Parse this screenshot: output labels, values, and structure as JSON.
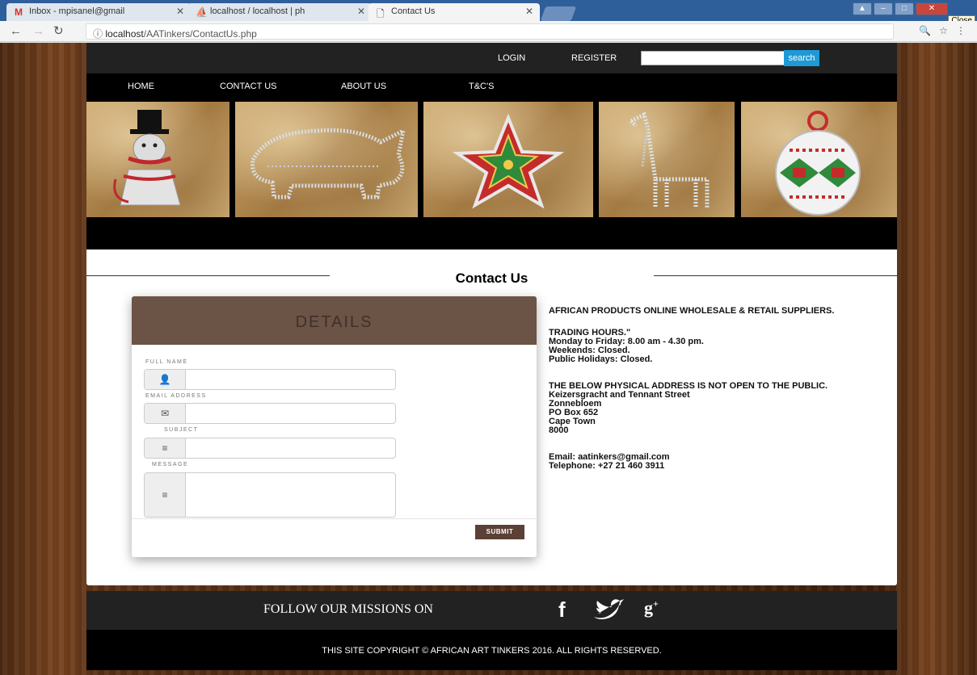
{
  "browser": {
    "tabs": [
      {
        "label": "Inbox - mpisanel@gmail",
        "icon": "gmail-icon"
      },
      {
        "label": "localhost / localhost | ph",
        "icon": "phpmyadmin-icon"
      },
      {
        "label": "Contact Us",
        "icon": "page-icon"
      }
    ],
    "close_tooltip": "Close",
    "url_prefix": "localhost",
    "url_path": "/AATinkers/ContactUs.php"
  },
  "topbar": {
    "login": "LOGIN",
    "register": "REGISTER",
    "search_value": "",
    "search_button": "search"
  },
  "nav": [
    "HOME",
    "CONTACT US",
    "ABOUT US",
    "T&C'S"
  ],
  "banner": {
    "items": [
      "snowman",
      "rhino",
      "star",
      "giraffe",
      "bauble"
    ]
  },
  "contact": {
    "title": "Contact Us",
    "form": {
      "header": "DETAILS",
      "full_name_label": "FULL NAME",
      "email_label": "EMAIL ADDRESS",
      "subject_label": "SUBJECT",
      "message_label": "MESSAGE",
      "submit": "SUBMIT"
    },
    "info": {
      "heading": "AFRICAN PRODUCTS ONLINE WHOLESALE & RETAIL SUPPLIERS.",
      "hours_title": "TRADING HOURS.\"",
      "hours_weekday": "Monday to Friday: 8.00 am - 4.30 pm.",
      "hours_weekend": "Weekends: Closed.",
      "hours_holiday": "Public Holidays: Closed.",
      "address_note": "THE BELOW PHYSICAL ADDRESS IS NOT OPEN TO THE PUBLIC.",
      "address_street": "Keizersgracht and Tennant Street",
      "address_suburb": "Zonnebloem",
      "address_po": "PO Box 652",
      "address_city": "Cape Town",
      "address_code": "8000",
      "email": "Email: aatinkers@gmail.com",
      "telephone": "Telephone: +27 21 460 3911"
    }
  },
  "footer": {
    "follow": "FOLLOW OUR MISSIONS ON",
    "copyright": "THIS SITE COPYRIGHT © AFRICAN ART TINKERS 2016. ALL RIGHTS RESERVED."
  }
}
